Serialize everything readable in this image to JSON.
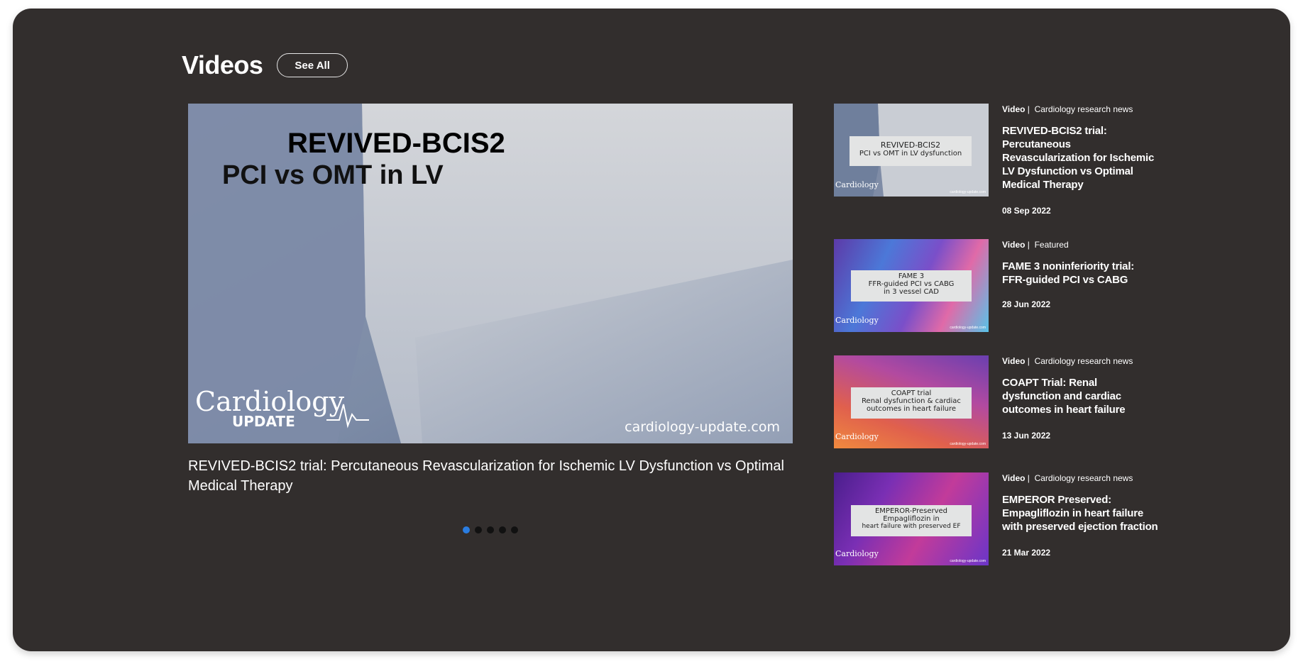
{
  "header": {
    "title": "Videos",
    "see_all_label": "See All"
  },
  "featured": {
    "thumb_line1": "REVIVED-BCIS2",
    "thumb_line2": "PCI vs OMT in LV",
    "brand_name": "Cardiology",
    "brand_sub": "UPDATE",
    "site": "cardiology-update.com",
    "title": "REVIVED-BCIS2 trial: Percutaneous Revascularization for Ischemic LV Dysfunction vs Optimal Medical Therapy"
  },
  "carousel": {
    "count": 5,
    "active_index": 0,
    "active_color": "#2a7de1"
  },
  "side_videos": [
    {
      "type": "Video",
      "category": "Cardiology research news",
      "title": "REVIVED-BCIS2 trial: Percutaneous Revascularization for Ischemic LV Dysfunction vs Optimal Medical Therapy",
      "date": "08 Sep 2022",
      "thumb_lines": [
        "REVIVED-BCIS2",
        "PCI vs OMT in LV dysfunction"
      ],
      "thumb_style": "grey"
    },
    {
      "type": "Video",
      "category": "Featured",
      "title": "FAME 3 noninferiority trial: FFR-guided PCI vs CABG",
      "date": "28 Jun 2022",
      "thumb_lines": [
        "FAME 3",
        "FFR-guided PCI vs CABG",
        "in 3 vessel CAD"
      ],
      "thumb_style": "blue-purple"
    },
    {
      "type": "Video",
      "category": "Cardiology research news",
      "title": "COAPT Trial: Renal dysfunction and cardiac outcomes in heart failure",
      "date": "13 Jun 2022",
      "thumb_lines": [
        "COAPT trial",
        "Renal dysfunction & cardiac",
        "outcomes in heart failure"
      ],
      "thumb_style": "orange-purple"
    },
    {
      "type": "Video",
      "category": "Cardiology research news",
      "title": "EMPEROR Preserved: Empagliflozin in heart failure with preserved ejection fraction",
      "date": "21 Mar 2022",
      "thumb_lines": [
        "EMPEROR-Preserved",
        "Empagliflozin in",
        "heart failure with preserved EF"
      ],
      "thumb_style": "magenta-purple"
    }
  ],
  "thumb_brand": {
    "name": "Cardiology",
    "sub": "UPDATE",
    "site": "cardiology-update.com"
  }
}
